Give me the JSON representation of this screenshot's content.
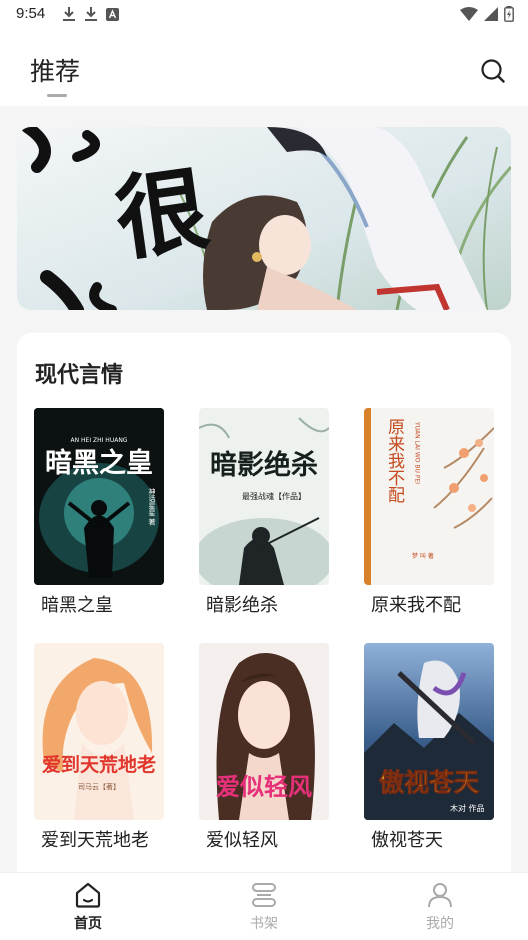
{
  "status_bar": {
    "time": "9:54"
  },
  "header": {
    "title": "推荐"
  },
  "section": {
    "title": "现代言情",
    "books": [
      {
        "title": "暗黑之皇",
        "cover_text": "暗黑之皇",
        "cover_subtext": "AN HEI ZHI HUANG",
        "cover_author": "神话星星 著"
      },
      {
        "title": "暗影绝杀",
        "cover_text": "暗影绝杀",
        "cover_subtext": "最强战魂【作品】"
      },
      {
        "title": "原来我不配",
        "cover_text": "原来我不配",
        "cover_subtext": "YUAN LAI WO BU PEI",
        "cover_author": "梦 叫 著"
      },
      {
        "title": "爱到天荒地老",
        "cover_text": "爱到天荒地老",
        "cover_subtext": "司马云【著】"
      },
      {
        "title": "爱似轻风",
        "cover_text": "爱似轻风"
      },
      {
        "title": "傲视苍天",
        "cover_text": "傲视苍天",
        "cover_author": "木对 作品"
      }
    ]
  },
  "banner": {
    "text": "很"
  },
  "bottom_nav": {
    "items": [
      {
        "label": "首页",
        "icon": "home-icon",
        "active": true
      },
      {
        "label": "书架",
        "icon": "bookshelf-icon",
        "active": false
      },
      {
        "label": "我的",
        "icon": "profile-icon",
        "active": false
      }
    ]
  },
  "colors": {
    "background": "#f5f5f5",
    "card": "#ffffff",
    "text": "#222222",
    "inactive": "#aaaaaa"
  }
}
